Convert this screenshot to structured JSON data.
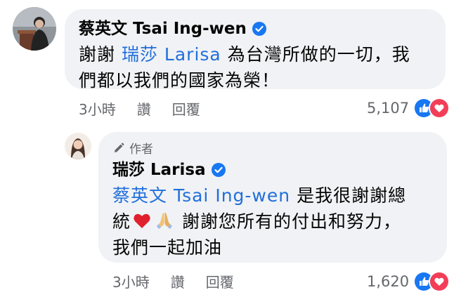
{
  "comment1": {
    "author": "蔡英文 Tsai Ing-wen",
    "text_mention": "瑞莎 Larisa",
    "text_prefix": "謝謝",
    "text_line1_rest": "為台灣所做的一切，我",
    "text_line2": "們都以我們的國家為榮！",
    "time": "3小時",
    "like_label": "讚",
    "reply_label": "回覆",
    "reaction_count": "5,107"
  },
  "comment2": {
    "author_tag": "作者",
    "author": "瑞莎 Larisa",
    "text_mention": "蔡英文 Tsai Ing-wen",
    "text_line1_rest": "是我很謝謝總",
    "text_line2_start": "統",
    "text_line2_rest": "謝謝您所有的付出和努力，",
    "text_line3": "我們一起加油",
    "time": "3小時",
    "like_label": "讚",
    "reply_label": "回覆",
    "reaction_count": "1,620"
  },
  "colors": {
    "bubble": "#f0f2f5",
    "mention": "#216fdb",
    "verified": "#1877f2",
    "like": "#1877f2",
    "love": "#f33e58",
    "meta": "#65676b"
  },
  "icons": {
    "verified": "verified-badge-icon",
    "author_tag": "pencil-icon",
    "like": "like-reaction-icon",
    "love": "love-reaction-icon",
    "heart_emoji": "red-heart-emoji",
    "pray_emoji": "folded-hands-emoji"
  }
}
